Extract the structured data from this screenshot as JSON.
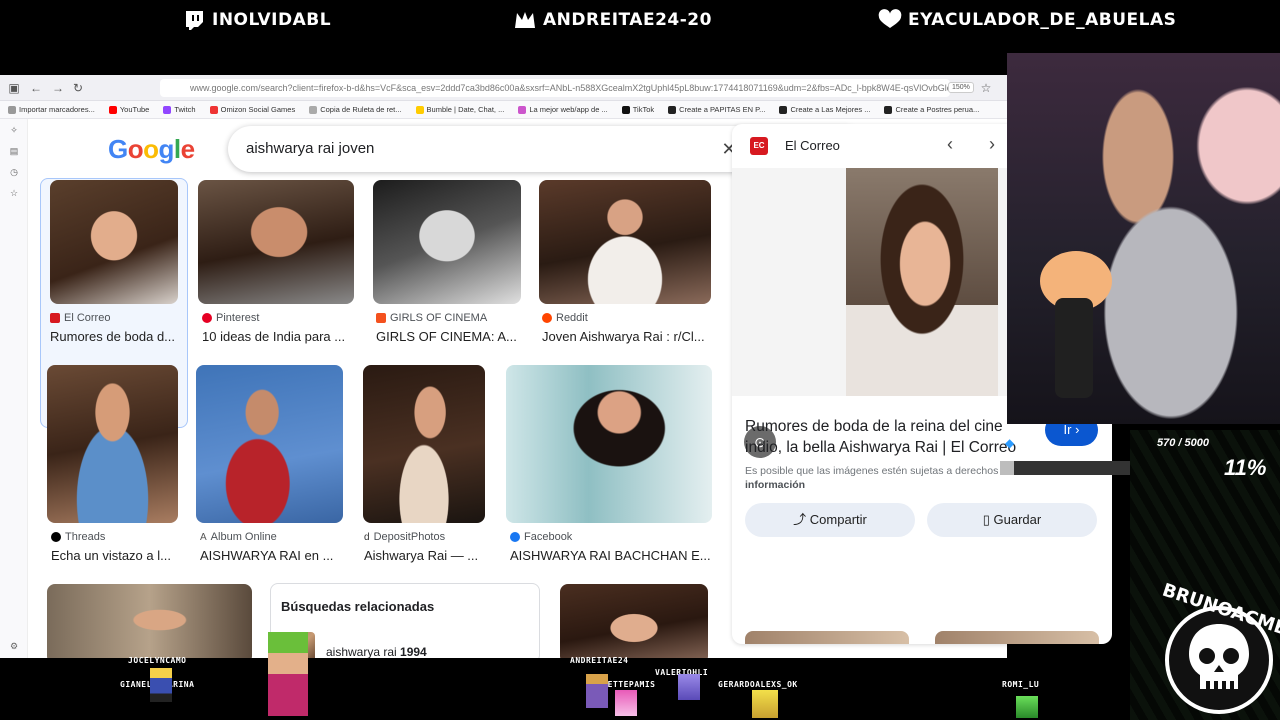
{
  "overlay": {
    "subs": [
      {
        "name": "INOLVIDABL"
      },
      {
        "name": "ANDREITAE24-20"
      },
      {
        "name": "EYACULADOR_DE_ABUELAS"
      }
    ],
    "goal": {
      "amount": "570 / 5000",
      "percent": "11%",
      "progress": 0.11
    },
    "viewers": [
      "JOCELYNCAMO",
      "GIANELLAKARINA",
      "ANDREITAE24",
      "VALERIOHLI",
      "YVETTEPAMIS",
      "GERARDOALEXS_OK",
      "ROMI_LU"
    ],
    "brand": "BRUNOACME"
  },
  "browser": {
    "url": "www.google.com/search?client=firefox-b-d&hs=VcF&sca_esv=2ddd7ca3bd86c00a&sxsrf=ANbL-n588XGcealmX2tgUphl45pL8buw:1774418071169&udm=2&fbs=ADc_l-bpk8W4E-qsVlOvbGlcDwpn60",
    "zoom": "150%",
    "bookmarks": [
      "Importar marcadores...",
      "YouTube",
      "Twitch",
      "Omizon Social Games",
      "Copia de Ruleta de ret...",
      "Bumble | Date, Chat, ...",
      "La mejor web/app de ...",
      "TikTok",
      "Create a PAPITAS EN P...",
      "Create a Las Mejores ...",
      "Create a Postres perua..."
    ]
  },
  "google": {
    "logo": "Google",
    "query": "aishwarya rai joven",
    "results": [
      {
        "source": "El Correo",
        "title": "Rumores de boda d..."
      },
      {
        "source": "Pinterest",
        "title": "10 ideas de India para ..."
      },
      {
        "source": "GIRLS OF CINEMA",
        "title": "GIRLS OF CINEMA: A..."
      },
      {
        "source": "Reddit",
        "title": "Joven Aishwarya Rai : r/Cl..."
      },
      {
        "source": "Threads",
        "title": "Echa un vistazo a l..."
      },
      {
        "source": "Album Online",
        "title": "AISHWARYA RAI en ..."
      },
      {
        "source": "DepositPhotos",
        "title": "Aishwarya Rai — ..."
      },
      {
        "source": "Facebook",
        "title": "AISHWARYA RAI BACHCHAN E..."
      }
    ],
    "related": {
      "heading": "Búsquedas relacionadas",
      "item_prefix": "aishwarya rai ",
      "item_bold": "1994"
    }
  },
  "preview": {
    "logo_text": "EC",
    "source": "El Correo",
    "title": "Rumores de boda de la reina del cine indio, la bella Aishwarya Rai | El Correo",
    "go": "Ir",
    "note": "Es posible que las imágenes estén sujetas a derechos de autor.",
    "note_more": "Más información",
    "share": "Compartir",
    "save": "Guardar"
  },
  "colors": {
    "accent": "#0b57d0",
    "selected_border": "#a8c7fa"
  }
}
